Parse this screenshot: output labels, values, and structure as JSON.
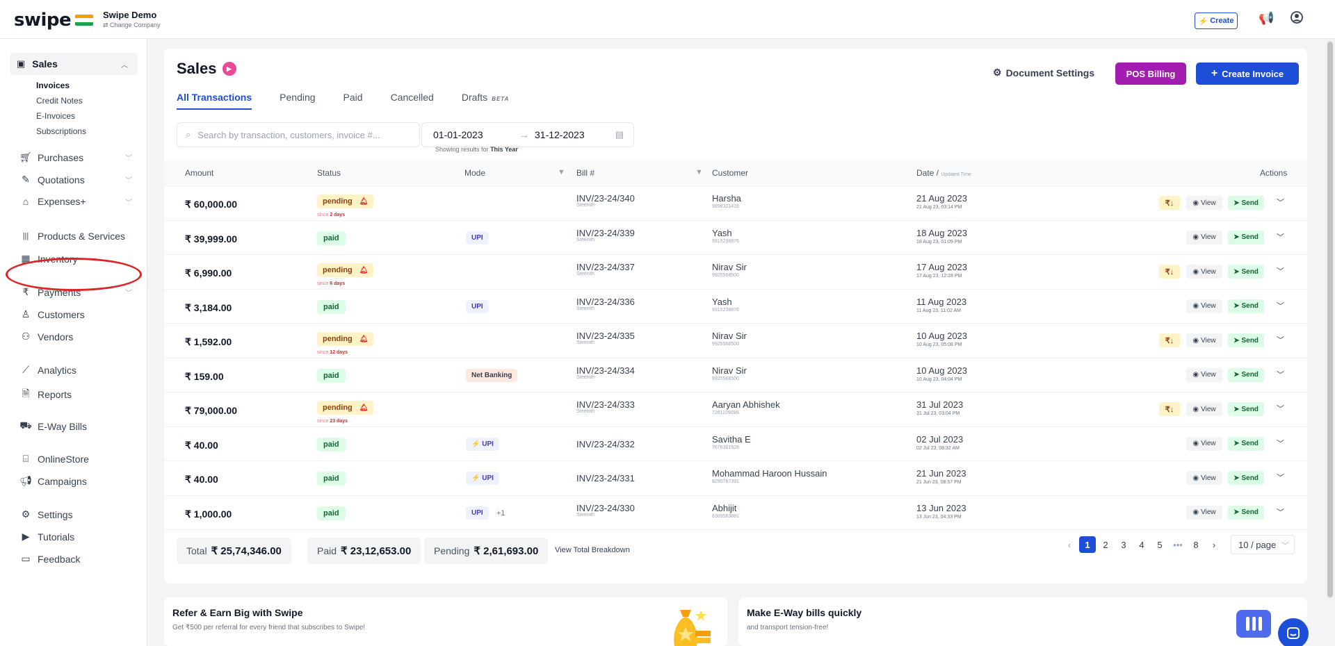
{
  "app": {
    "brand": "swipe",
    "company_name": "Swipe Demo",
    "change_company": "⇄ Change Company",
    "create_label": "Create"
  },
  "sidebar": {
    "sales": {
      "label": "Sales",
      "sub_items": [
        "Invoices",
        "Credit Notes",
        "E-Invoices",
        "Subscriptions"
      ]
    },
    "items": [
      {
        "label": "Purchases",
        "icon": "cart-icon",
        "has_chevron": true
      },
      {
        "label": "Quotations",
        "icon": "pen-icon",
        "has_chevron": true
      },
      {
        "label": "Expenses+",
        "icon": "tag-icon",
        "has_chevron": true
      },
      {
        "label": "Products & Services",
        "icon": "barcode-icon",
        "has_chevron": false
      },
      {
        "label": "Inventory",
        "icon": "warehouse-icon",
        "has_chevron": false
      },
      {
        "label": "Payments",
        "icon": "rupee-icon",
        "has_chevron": true
      },
      {
        "label": "Customers",
        "icon": "user-icon",
        "has_chevron": false
      },
      {
        "label": "Vendors",
        "icon": "users-icon",
        "has_chevron": false
      },
      {
        "label": "Analytics",
        "icon": "chart-icon",
        "has_chevron": false
      },
      {
        "label": "Reports",
        "icon": "report-icon",
        "has_chevron": false
      },
      {
        "label": "E-Way Bills",
        "icon": "truck-icon",
        "has_chevron": false
      },
      {
        "label": "OnlineStore",
        "icon": "store-icon",
        "has_chevron": false
      },
      {
        "label": "Campaigns",
        "icon": "megaphone-icon",
        "has_chevron": false
      },
      {
        "label": "Settings",
        "icon": "gear-icon",
        "has_chevron": false
      },
      {
        "label": "Tutorials",
        "icon": "youtube-icon",
        "has_chevron": false
      },
      {
        "label": "Feedback",
        "icon": "feedback-icon",
        "has_chevron": false
      }
    ]
  },
  "main": {
    "title": "Sales",
    "tabs": [
      "All Transactions",
      "Pending",
      "Paid",
      "Cancelled",
      "Drafts"
    ],
    "beta_label": "BETA",
    "document_settings": "Document Settings",
    "pos_billing": "POS Billing",
    "create_invoice": "Create Invoice",
    "search_placeholder": "Search by transaction, customers, invoice #...",
    "date_from": "01-01-2023",
    "date_to": "31-12-2023",
    "showing_prefix": "Showing results for",
    "showing_period": "This Year",
    "columns": [
      "Amount",
      "Status",
      "Mode",
      "Bill #",
      "Customer",
      "Date /",
      "Updated Time",
      "Actions"
    ],
    "view_label": "View",
    "send_label": "Send"
  },
  "rows": [
    {
      "amount": "₹ 60,000.00",
      "status": "pending",
      "since_prefix": "since",
      "since": "2 days",
      "mode": "",
      "mode_extra": "",
      "bill": "INV/23-24/340",
      "bill_sub": "Sreenith",
      "customer": "Harsha",
      "customer_phone": "9898321416",
      "date": "21 Aug 2023",
      "date_sub": "21 Aug 23, 03:14 PM",
      "rupee_action": "₹↓"
    },
    {
      "amount": "₹ 39,999.00",
      "status": "paid",
      "since_prefix": "",
      "since": "",
      "mode": "UPI",
      "mode_extra": "",
      "bill": "INV/23-24/339",
      "bill_sub": "Sreenith",
      "customer": "Yash",
      "customer_phone": "9315238876",
      "date": "18 Aug 2023",
      "date_sub": "18 Aug 23, 01:09 PM",
      "rupee_action": ""
    },
    {
      "amount": "₹ 6,990.00",
      "status": "pending",
      "since_prefix": "since",
      "since": "6 days",
      "mode": "",
      "mode_extra": "",
      "bill": "INV/23-24/337",
      "bill_sub": "Sreenith",
      "customer": "Nirav Sir",
      "customer_phone": "9925568500",
      "date": "17 Aug 2023",
      "date_sub": "17 Aug 23, 12:28 PM",
      "rupee_action": "₹↓"
    },
    {
      "amount": "₹ 3,184.00",
      "status": "paid",
      "since_prefix": "",
      "since": "",
      "mode": "UPI",
      "mode_extra": "",
      "bill": "INV/23-24/336",
      "bill_sub": "Sreenith",
      "customer": "Yash",
      "customer_phone": "9315238876",
      "date": "11 Aug 2023",
      "date_sub": "11 Aug 23, 11:02 AM",
      "rupee_action": ""
    },
    {
      "amount": "₹ 1,592.00",
      "status": "pending",
      "since_prefix": "since",
      "since": "12 days",
      "mode": "",
      "mode_extra": "",
      "bill": "INV/23-24/335",
      "bill_sub": "Sreenith",
      "customer": "Nirav Sir",
      "customer_phone": "9925568500",
      "date": "10 Aug 2023",
      "date_sub": "10 Aug 23, 05:08 PM",
      "rupee_action": "₹↓"
    },
    {
      "amount": "₹ 159.00",
      "status": "paid",
      "since_prefix": "",
      "since": "",
      "mode": "Net Banking",
      "mode_extra": "",
      "bill": "INV/23-24/334",
      "bill_sub": "Sreenith",
      "customer": "Nirav Sir",
      "customer_phone": "9925568500",
      "date": "10 Aug 2023",
      "date_sub": "10 Aug 23, 04:04 PM",
      "rupee_action": ""
    },
    {
      "amount": "₹ 79,000.00",
      "status": "pending",
      "since_prefix": "since",
      "since": "23 days",
      "mode": "",
      "mode_extra": "",
      "bill": "INV/23-24/333",
      "bill_sub": "Sreenith",
      "customer": "Aaryan Abhishek",
      "customer_phone": "7261109099",
      "date": "31 Jul 2023",
      "date_sub": "31 Jul 23, 03:04 PM",
      "rupee_action": "₹↓"
    },
    {
      "amount": "₹ 40.00",
      "status": "paid",
      "since_prefix": "",
      "since": "",
      "mode": "⚡ UPI",
      "mode_extra": "",
      "bill": "INV/23-24/332",
      "bill_sub": "",
      "customer": "Savitha E",
      "customer_phone": "7676361928",
      "date": "02 Jul 2023",
      "date_sub": "02 Jul 23, 08:32 AM",
      "rupee_action": ""
    },
    {
      "amount": "₹ 40.00",
      "status": "paid",
      "since_prefix": "",
      "since": "",
      "mode": "⚡ UPI",
      "mode_extra": "",
      "bill": "INV/23-24/331",
      "bill_sub": "",
      "customer": "Mohammad Haroon Hussain",
      "customer_phone": "8290767391",
      "date": "21 Jun 2023",
      "date_sub": "21 Jun 23, 08:57 PM",
      "rupee_action": ""
    },
    {
      "amount": "₹ 1,000.00",
      "status": "paid",
      "since_prefix": "",
      "since": "",
      "mode": "UPI",
      "mode_extra": "+1",
      "bill": "INV/23-24/330",
      "bill_sub": "Sreenith",
      "customer": "Abhijit",
      "customer_phone": "6309563881",
      "date": "13 Jun 2023",
      "date_sub": "13 Jun 23, 04:33 PM",
      "rupee_action": ""
    }
  ],
  "totals": {
    "total_label": "Total",
    "total_value": "₹ 25,74,346.00",
    "paid_label": "Paid",
    "paid_value": "₹ 23,12,653.00",
    "pending_label": "Pending",
    "pending_value": "₹ 2,61,693.00",
    "breakdown": "View Total Breakdown"
  },
  "pagination": {
    "pages": [
      "1",
      "2",
      "3",
      "4",
      "5",
      "•••",
      "8"
    ],
    "current": "1",
    "per_page": "10 / page"
  },
  "promos": [
    {
      "title": "Refer & Earn Big with Swipe",
      "subtitle": "Get ₹500 per referral for every friend that subscribes to Swipe!"
    },
    {
      "title": "Make E-Way bills quickly",
      "subtitle": "and transport tension-free!"
    }
  ],
  "colors": {
    "accent": "#1d4ed8",
    "pos": "#a21caf",
    "pending_bg": "#fef3c7",
    "paid_bg": "#dcfce7",
    "annotation_circle": "#dc2626"
  }
}
